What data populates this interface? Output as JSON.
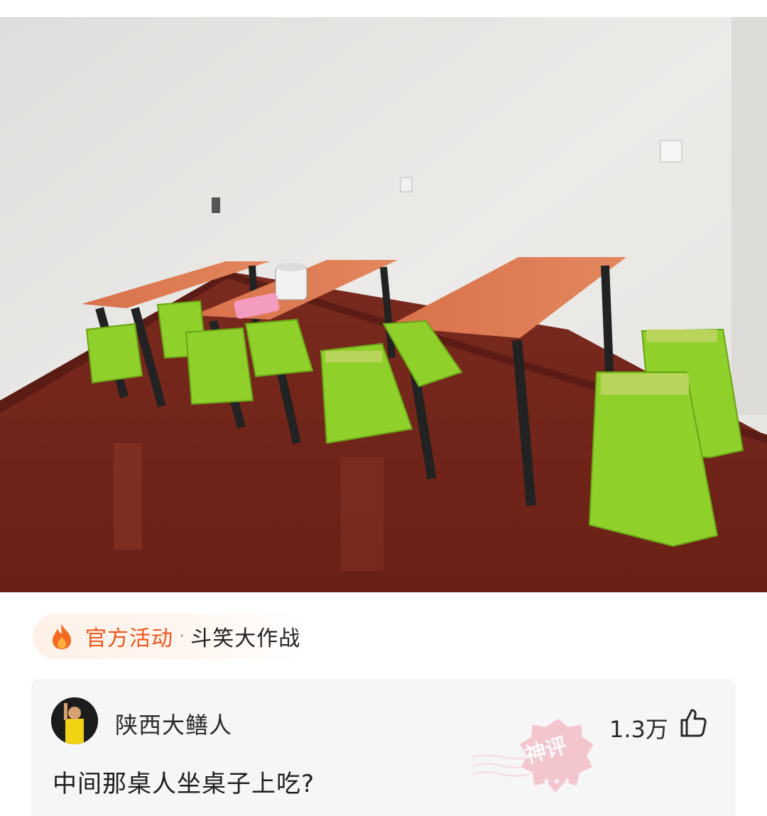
{
  "activity": {
    "icon": "flame-icon",
    "label": "官方活动",
    "separator": "·",
    "name": "斗笑大作战",
    "accent_color": "#f0561c"
  },
  "comment": {
    "username": "陕西大鳝人",
    "text": "中间那桌人坐桌子上吃?",
    "like_count": "1.3万",
    "like_icon": "thumbs-up-icon",
    "stamp_text": "神评",
    "stamp_color": "#f2a0ae"
  }
}
